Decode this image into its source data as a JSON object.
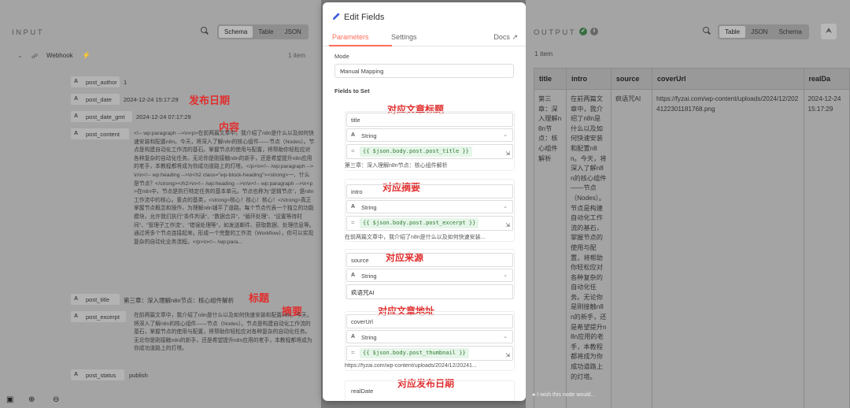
{
  "input": {
    "title": "INPUT",
    "tabs": [
      "Schema",
      "Table",
      "JSON"
    ],
    "node": {
      "name": "Webhook",
      "count": "1 item"
    },
    "fields": [
      {
        "type": "A",
        "name": "post_author",
        "value": "1"
      },
      {
        "type": "A",
        "name": "post_date",
        "value": "2024-12-24 15:17:29"
      },
      {
        "type": "A",
        "name": "post_date_gmt",
        "value": "2024-12-24 07:17:29"
      },
      {
        "type": "A",
        "name": "post_content",
        "value": "<!-- wp:paragraph -->\\n<p>在前两篇文章中，我介绍了n8n是什么以及如何快速安装和配置n8n。今天，将深入了解n8n的核心组件——节点（Nodes）。节点是构建自动化工作流的基石。掌握节点的使用与配置，将帮助你轻松应对各种复杂的自动化任务。无论你是刚接触n8n的新手，还是希望提升n8n应用的老手，本教程都将成为你成功道路上的灯塔。</p>\\n<!-- /wp:paragraph -->\\n\\n<!-- wp:heading -->\\n<h2 class=\"wp-block-heading\"><strong>一、什么是节点？</strong></h2>\\n<!-- /wp:heading -->\\n\\n<!-- wp:paragraph -->\\n<p>在n8n中，节点是执行特定任务的基本单元。节点也称为\"逻辑节点\"，是n8n工作流中的核心。重点的基类，<strong>核心！核心！核心！</strong>真正掌握节点概念和操作，为理解n8n铺平了道路。每个节点代表一个独立的功能模块，允许我们执行\"条件判读\"、\"数据合并\"、\"循环处理\"、\"设置等待时间\"、\"管理子工作流\"、\"错误处理等\"，如发送邮件、获取数据、处理信息等。通过将多个节点连接起来，形成一个完整的工作流（Workflow），你可以实现复杂的自动化业务流程。</p>\\n<!-- /wp:para..."
      },
      {
        "type": "A",
        "name": "post_title",
        "value": "第三章：深入理解n8n节点：核心组件解析"
      },
      {
        "type": "A",
        "name": "post_excerpt",
        "value": "在前两篇文章中，我介绍了n8n是什么以及如何快速安装和配置n8n。今天，将深入了解n8n的核心组件——节点（Nodes）。节点是构建自动化工作流的基石，掌握节点的使用与配置，将帮助你轻松应对各种复杂的自动化任务。无论你是刚接触n8n的新手，还是希望提升n8n应用的老手，本教程都将成为你成功道路上的灯塔。"
      },
      {
        "type": "A",
        "name": "post_status",
        "value": "publish"
      }
    ],
    "annotations": {
      "date": "发布日期",
      "content": "内容",
      "title": "标题",
      "excerpt": "摘要"
    }
  },
  "modal": {
    "title": "Edit Fields",
    "tabs": {
      "parameters": "Parameters",
      "settings": "Settings",
      "docs": "Docs"
    },
    "mode_label": "Mode",
    "mode_value": "Manual Mapping",
    "fields_label": "Fields to Set",
    "assignments": [
      {
        "annotation": "对应文章标题",
        "name": "title",
        "type_icon": "A",
        "type": "String",
        "expr": "{{ $json.body.post.post_title }}",
        "preview": "第三章：深入理解n8n节点：核心组件解析"
      },
      {
        "annotation": "对应摘要",
        "name": "intro",
        "type_icon": "A",
        "type": "String",
        "expr": "{{ $json.body.post.post_excerpt }}",
        "preview": "在前两篇文章中，我介绍了n8n是什么以及如何快速安装..."
      },
      {
        "annotation": "对应来源",
        "name": "source",
        "type_icon": "A",
        "type": "String",
        "expr": "",
        "preview": "疯语咒AI"
      },
      {
        "annotation": "对应文章地址",
        "name": "coverUrl",
        "type_icon": "A",
        "type": "String",
        "expr": "{{ $json.body.post_thumbnail }}",
        "preview": "https://fyzai.com/wp-content/uploads/2024/12/20241..."
      },
      {
        "annotation": "对应发布日期",
        "name": "realDate"
      }
    ]
  },
  "output": {
    "title": "OUTPUT",
    "tabs": [
      "Table",
      "JSON",
      "Schema"
    ],
    "count": "1 item",
    "columns": [
      "title",
      "intro",
      "source",
      "coverUrl",
      "realDa"
    ],
    "row": {
      "title": "第三章：深入理解n8n节点：核心组件解析",
      "intro": "在前两篇文章中，我介绍了n8n是什么以及如何快速安装和配置n8n。今天，将深入了解n8n的核心组件——节点（Nodes）。节点是构建自动化工作流的基石，掌握节点的使用与配置，将帮助你轻松应对各种复杂的自动化任务。无论你是刚接触n8n的新手，还是希望提升n8n应用的老手，本教程都将成为你成功道路上的灯塔。",
      "source": "疯语咒AI",
      "coverUrl": "https://fyzai.com/wp-content/uploads/2024/12/2024122301181768.png",
      "realDate": "2024-12-24 15:17:29"
    }
  },
  "footer": {
    "tip": "I wish this node would..."
  },
  "colors": {
    "accent": "#ff6d5a",
    "annotation": "#e02e2e",
    "success": "#3a6e45"
  }
}
